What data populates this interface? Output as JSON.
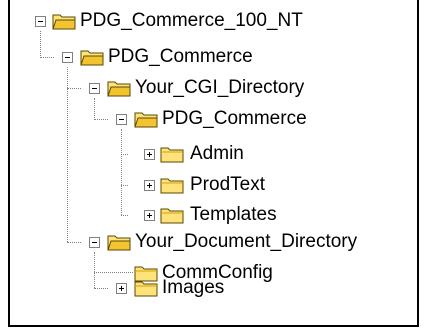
{
  "tree": {
    "root": {
      "label": "PDG_Commerce_100_NT",
      "expanded": true
    },
    "pdg_commerce": {
      "label": "PDG_Commerce",
      "expanded": true
    },
    "your_cgi_directory": {
      "label": "Your_CGI_Directory",
      "expanded": true
    },
    "cgi_pdg_commerce": {
      "label": "PDG_Commerce",
      "expanded": true
    },
    "admin": {
      "label": "Admin",
      "expanded": false
    },
    "prodtext": {
      "label": "ProdText",
      "expanded": false
    },
    "templates": {
      "label": "Templates",
      "expanded": false
    },
    "your_document_directory": {
      "label": "Your_Document_Directory",
      "expanded": true
    },
    "commconfig": {
      "label": "CommConfig"
    },
    "images": {
      "label": "Images",
      "expanded": false
    }
  },
  "colors": {
    "folder_fill": "#ffe27a",
    "folder_shade": "#d4a20c",
    "folder_outline": "#5a4a00",
    "connector": "#808080"
  }
}
